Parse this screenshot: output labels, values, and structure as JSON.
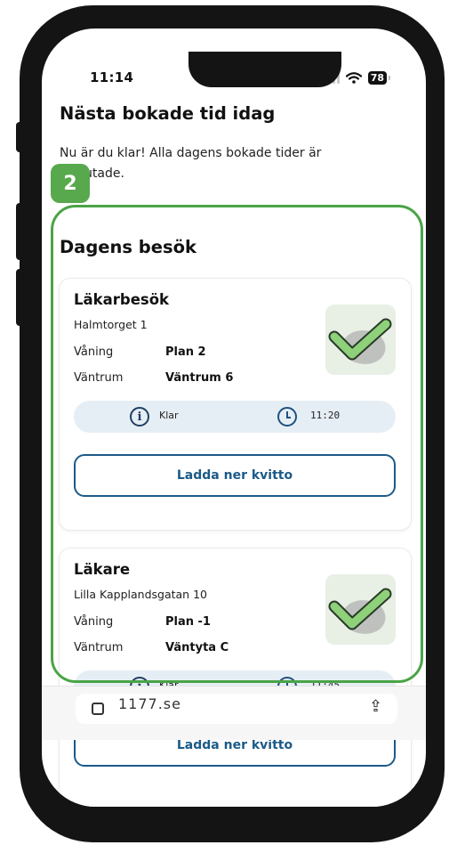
{
  "status_bar": {
    "time": "11:14",
    "battery": "78"
  },
  "page": {
    "title": "Nästa bokade tid idag",
    "intro": "Nu är du klar! Alla dagens bokade tider är avslutade.",
    "annotation_number": "2",
    "section_title": "Dagens besök"
  },
  "labels": {
    "floor": "Våning",
    "waiting_room": "Väntrum"
  },
  "visits": [
    {
      "title": "Läkarbesök",
      "address": "Halmtorget 1",
      "floor": "Plan 2",
      "waiting_room": "Väntrum 6",
      "status": "Klar",
      "time": "11:20",
      "button": "Ladda ner kvitto"
    },
    {
      "title": "Läkare",
      "address": "Lilla Kapplandsgatan 10",
      "floor": "Plan -1",
      "waiting_room": "Väntyta C",
      "status": "Klar",
      "time": "11:45",
      "button": "Ladda ner kvitto"
    }
  ],
  "browser": {
    "url_partial": "1177.se"
  },
  "icons": [
    "signal-icon",
    "wifi-icon",
    "battery-icon",
    "checkmark-icon",
    "info-icon",
    "clock-icon",
    "tabs-icon",
    "share-icon"
  ],
  "colors": {
    "highlight": "#4aa446",
    "primary": "#1b5a88",
    "check_bg": "#e8f0e6",
    "info_bar": "#e6eef5"
  }
}
